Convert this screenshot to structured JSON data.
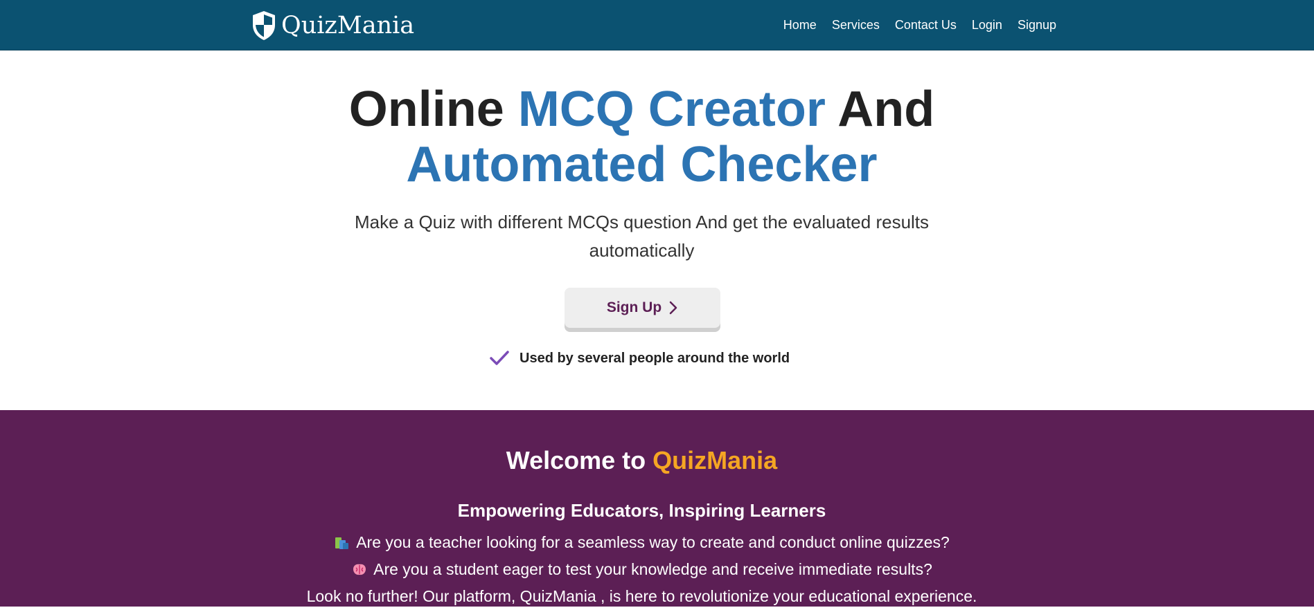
{
  "nav": {
    "brand": "QuizMania",
    "links": [
      "Home",
      "Services",
      "Contact Us",
      "Login",
      "Signup"
    ]
  },
  "hero": {
    "title_part1": "Online",
    "title_accent1": "MCQ Creator",
    "title_part2": "And",
    "title_accent2": "Automated Checker",
    "subtitle_line1": "Make a Quiz with different MCQs question And get the evaluated results",
    "subtitle_line2": "automatically",
    "cta_label": "Sign Up",
    "trust_text": "Used by several people around the world"
  },
  "welcome": {
    "title_prefix": "Welcome to",
    "title_brand": "QuizMania",
    "subtitle": "Empowering Educators, Inspiring Learners",
    "line1": "Are you a teacher looking for a seamless way to create and conduct online quizzes?",
    "line1_icon": "books-icon",
    "line2": "Are you a student eager to test your knowledge and receive immediate results?",
    "line2_icon": "brain-icon",
    "line3": "Look no further! Our platform, QuizMania , is here to revolutionize your educational experience."
  },
  "colors": {
    "navbar": "#0b5271",
    "accent_blue": "#2c74b3",
    "welcome_bg": "#5c1f55",
    "brand_orange": "#f5a623",
    "button_text": "#5c1f55",
    "check": "#7b4bb7"
  }
}
